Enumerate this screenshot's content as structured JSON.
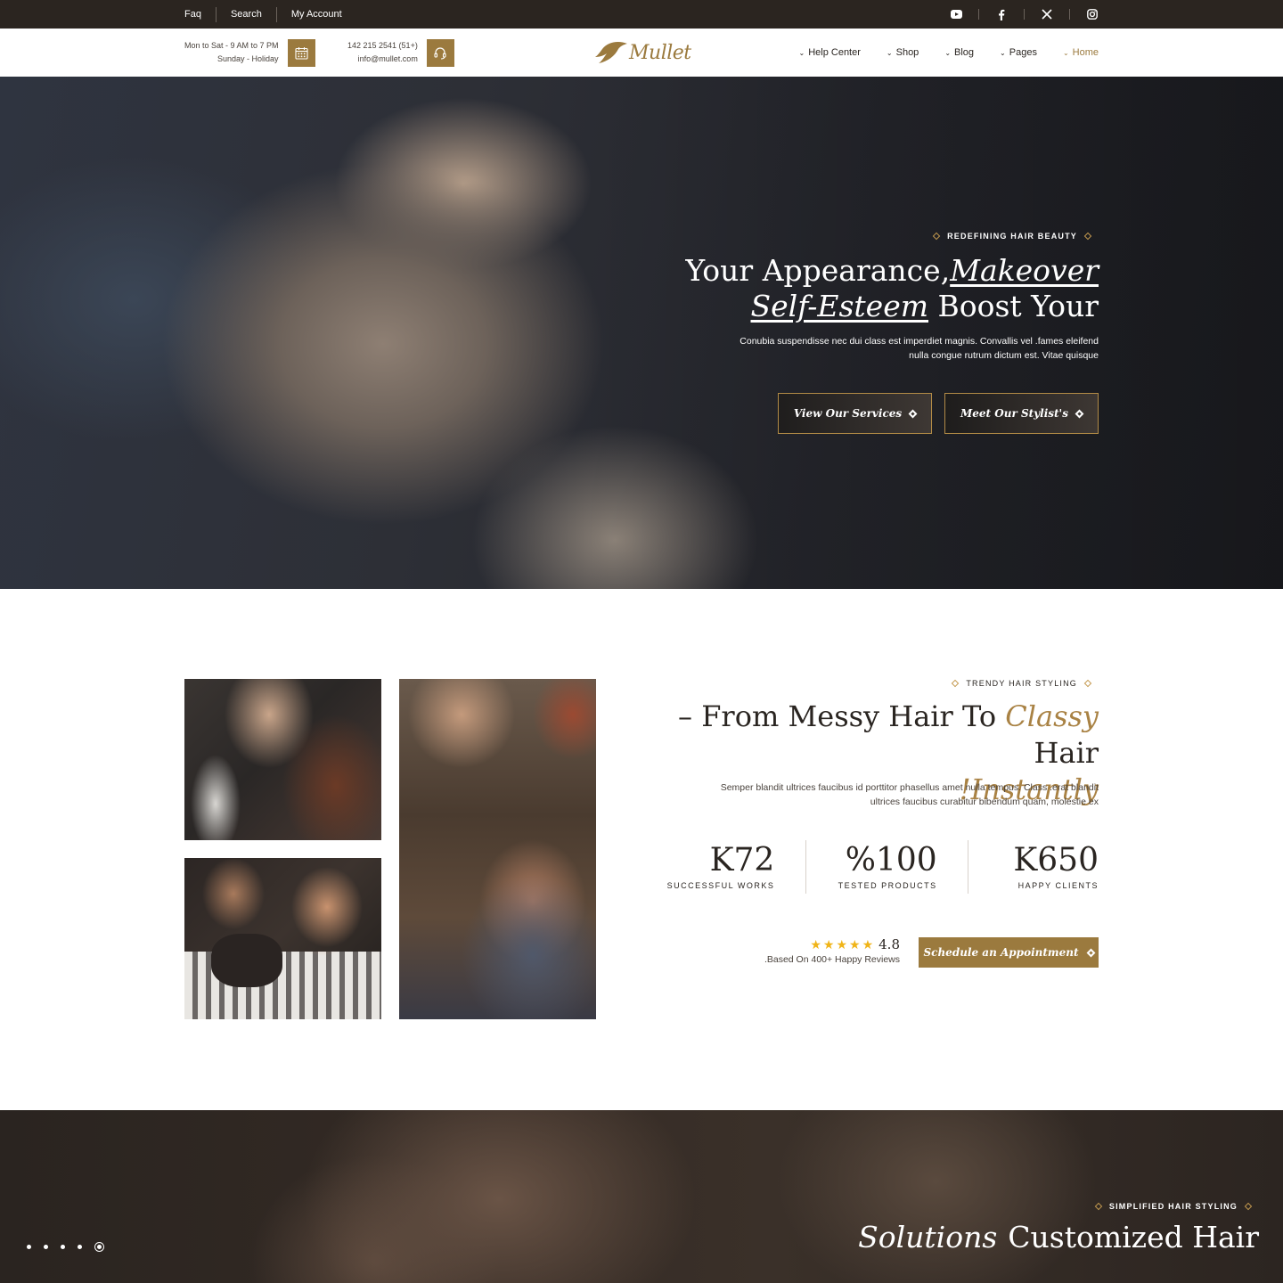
{
  "topbar": {
    "links": [
      "Faq",
      "Search",
      "My Account"
    ],
    "social": [
      "youtube-icon",
      "facebook-icon",
      "x-icon",
      "instagram-icon"
    ]
  },
  "header": {
    "hours_line1": "Mon to Sat - 9 AM to 7 PM",
    "hours_line2": "Sunday -  Holiday",
    "phone": "142 215 2541 (51+)",
    "email": "info@mullet.com",
    "logo": "Mullet",
    "nav": [
      "Help Center",
      "Shop",
      "Blog",
      "Pages",
      "Home"
    ],
    "active_nav": "Home"
  },
  "hero": {
    "eyebrow": "REDEFINING HAIR BEAUTY",
    "title_plain_1": "Your Appearance,",
    "title_italic_1": "Makeover",
    "title_italic_2": "Self-Esteem",
    "title_plain_2": " Boost Your",
    "description": "Conubia suspendisse nec dui class est imperdiet magnis. Convallis vel .fames eleifend nulla congue rutrum dictum est. Vitae quisque",
    "button_services": "View Our Services",
    "button_stylists": "Meet Our Stylist's"
  },
  "about": {
    "eyebrow": "TRENDY HAIR STYLING",
    "title_plain_1": "– From Messy Hair To ",
    "title_gold_1": "Classy",
    "title_plain_2": " Hair",
    "title_gold_2": "!Instantly",
    "description": "Semper blandit ultrices faucibus id porttitor phasellus amet nulla tempus. Class .erat blandit ultrices faucibus curabitur bibendum quam, molestie ex",
    "stats": [
      {
        "value": "K72",
        "label": "SUCCESSFUL WORKS"
      },
      {
        "value": "%100",
        "label": "TESTED PRODUCTS"
      },
      {
        "value": "K650",
        "label": "HAPPY CLIENTS"
      }
    ],
    "rating_score": "4.8",
    "rating_stars": 5,
    "rating_text": ".Based On 400+ Happy Reviews",
    "appointment_button": "Schedule an Appointment"
  },
  "solutions": {
    "eyebrow": "SIMPLIFIED HAIR STYLING",
    "title_italic": "Solutions",
    "title_plain": "Customized Hair"
  },
  "colors": {
    "accent": "#9b7a3e",
    "dark": "#2b2520",
    "star": "#f0b418"
  }
}
